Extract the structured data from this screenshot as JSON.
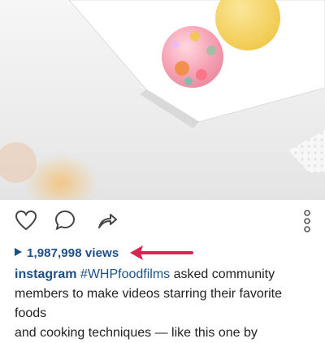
{
  "video": {
    "icon": "video-frame"
  },
  "actions": {
    "like_icon": "heart-icon",
    "comment_icon": "comment-icon",
    "share_icon": "share-icon",
    "more_icon": "more-vertical-icon"
  },
  "views": {
    "text": "1,987,998 views",
    "annotation_color": "#d7264f"
  },
  "caption": {
    "username": "instagram",
    "hashtag": "#WHPfoodfilms",
    "text_1": " asked community",
    "text_2": "members to make videos starring their favorite foods",
    "text_3": "and cooking techniques — like this one by"
  },
  "colors": {
    "link": "#1c4f86",
    "text": "#222222"
  }
}
